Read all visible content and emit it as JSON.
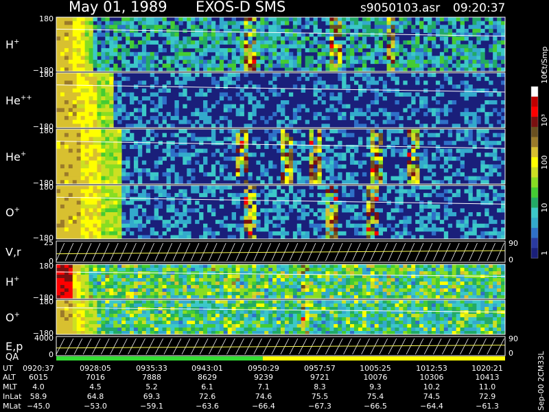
{
  "header": {
    "date": "May 01, 1989",
    "instrument": "EXOS-D SMS",
    "filename": "s9050103.asr",
    "time": "09:20:37"
  },
  "colors": {
    "background": "#000000",
    "text": "#ffffff",
    "no_data": "#1a1f7a",
    "trace": "#ffffff",
    "qa_bar_good": "#33dd33",
    "qa_bar_other": "#ffff00"
  },
  "chart_data": {
    "type": "heatmap",
    "title": "May 01, 1989   EXOS-D SMS",
    "subtitle": "s9050103.asr   09:20:37",
    "colorbar": {
      "unit": "Ct/Smp",
      "tick_labels": [
        "1",
        "10",
        "100",
        "10³",
        "10⁴"
      ],
      "scale": "log",
      "colors": [
        "#1a1f7a",
        "#2a3aa0",
        "#2f70c8",
        "#33aacc",
        "#3cc8c8",
        "#22aa66",
        "#44cc33",
        "#88dd22",
        "#cce022",
        "#ffff00",
        "#d8c030",
        "#9b7b2a",
        "#6a5020",
        "#7a1010",
        "#ff0000",
        "#c00000",
        "#ffffff"
      ]
    },
    "panels": [
      {
        "label": "H",
        "sup": "+",
        "ytop": "180",
        "ybottom": "−180",
        "kind": "pitch",
        "seed": 11,
        "intensity": 0.75,
        "onset": 0.08,
        "peaks": [
          0.43,
          0.62,
          0.74
        ]
      },
      {
        "label": "He",
        "sup": "++",
        "ytop": "180",
        "ybottom": "−180",
        "kind": "pitch",
        "seed": 23,
        "intensity": 0.35,
        "onset": 0.12,
        "peaks": []
      },
      {
        "label": "He",
        "sup": "+",
        "ytop": "180",
        "ybottom": "−180",
        "kind": "pitch",
        "seed": 37,
        "intensity": 0.42,
        "onset": 0.14,
        "peaks": [
          0.41,
          0.51,
          0.57,
          0.71,
          0.79
        ]
      },
      {
        "label": "O",
        "sup": "+",
        "ytop": "180",
        "ybottom": "−180",
        "kind": "pitch",
        "seed": 51,
        "intensity": 0.45,
        "onset": 0.14,
        "peaks": [
          0.43,
          0.61,
          0.7
        ]
      },
      {
        "label": "V,r",
        "sup": "",
        "ytop": "25",
        "ybottom": "0",
        "right_top": "90",
        "right_bottom": "0",
        "kind": "sawtooth",
        "count": 50
      },
      {
        "label": "H",
        "sup": "+",
        "ytop": "180",
        "ybottom": "−180",
        "kind": "stripes",
        "seed": 67,
        "intensity": 0.7,
        "onset": 0.07,
        "peaks": [
          0.55
        ]
      },
      {
        "label": "O",
        "sup": "+",
        "ytop": "180",
        "ybottom": "−180",
        "kind": "stripes",
        "seed": 83,
        "intensity": 0.5,
        "onset": 0.09,
        "peaks": [
          0.55
        ]
      },
      {
        "label": "E,p",
        "sup": "",
        "ytop": "4000",
        "ybottom": "0",
        "right_top": "90",
        "right_bottom": "0",
        "kind": "sawtooth",
        "count": 50
      }
    ],
    "qa": {
      "label": "QA",
      "good_fraction": 0.46
    },
    "footer": {
      "row_labels": [
        "UT",
        "ALT",
        "MLT",
        "InLat",
        "MLat"
      ],
      "columns": [
        [
          "0920:37",
          "6015",
          "4.0",
          "58.9",
          "−45.0"
        ],
        [
          "0928:05",
          "7016",
          "4.5",
          "64.8",
          "−53.0"
        ],
        [
          "0935:33",
          "7888",
          "5.2",
          "69.3",
          "−59.1"
        ],
        [
          "0943:01",
          "8629",
          "6.1",
          "72.6",
          "−63.6"
        ],
        [
          "0950:29",
          "9239",
          "7.1",
          "74.6",
          "−66.4"
        ],
        [
          "0957:57",
          "9721",
          "8.3",
          "75.5",
          "−67.3"
        ],
        [
          "1005:25",
          "10076",
          "9.3",
          "75.4",
          "−66.5"
        ],
        [
          "1012:53",
          "10306",
          "10.2",
          "74.5",
          "−64.4"
        ],
        [
          "1020:21",
          "10413",
          "11.0",
          "72.9",
          "−61.3"
        ]
      ]
    },
    "side_note": "Sep-00 2CM33L"
  }
}
